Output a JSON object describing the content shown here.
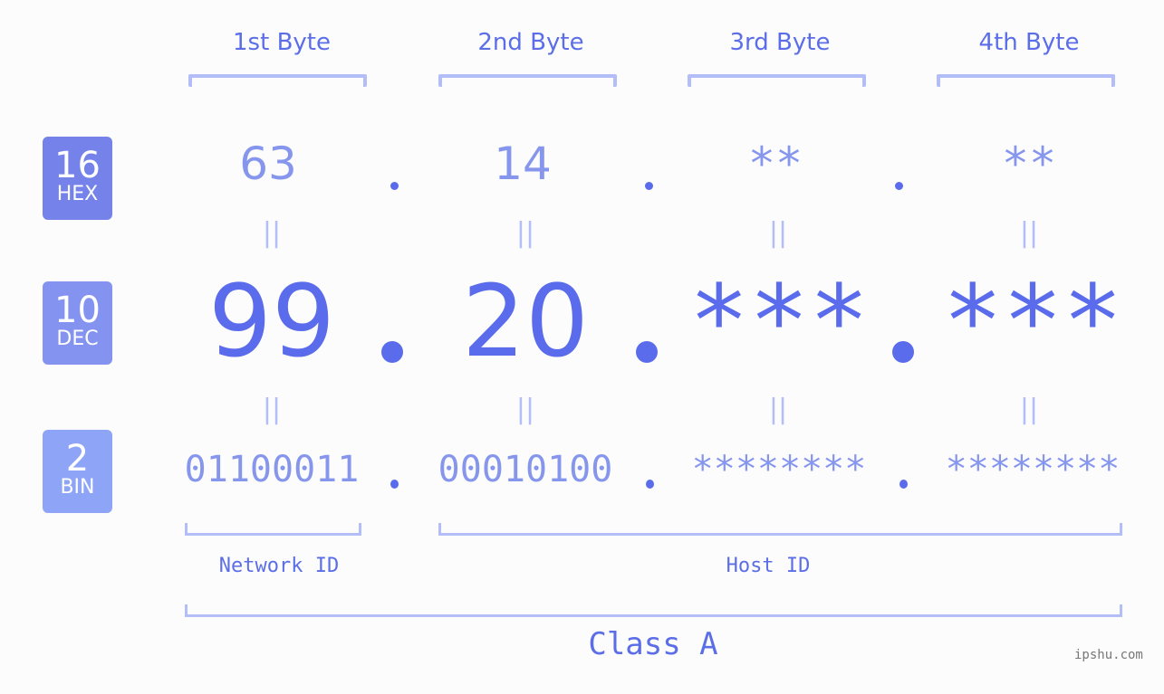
{
  "byte_headers": [
    "1st Byte",
    "2nd Byte",
    "3rd Byte",
    "4th Byte"
  ],
  "badges": {
    "hex": {
      "number": "16",
      "label": "HEX",
      "color": "#7482ea"
    },
    "dec": {
      "number": "10",
      "label": "DEC",
      "color": "#8493f0"
    },
    "bin": {
      "number": "2",
      "label": "BIN",
      "color": "#8ea5f7"
    }
  },
  "hex_values": [
    "63",
    "14",
    "**",
    "**"
  ],
  "dec_values": [
    "99",
    "20",
    "***",
    "***"
  ],
  "bin_values": [
    "01100011",
    "00010100",
    "********",
    "********"
  ],
  "equals_symbol": "||",
  "labels": {
    "network_id": "Network ID",
    "host_id": "Host ID",
    "class": "Class A"
  },
  "watermark": "ipshu.com",
  "colors": {
    "accent": "#5a6ceb",
    "light_accent": "#8796ed",
    "bracket": "#b3bdf7",
    "background": "#fbfcfb"
  }
}
